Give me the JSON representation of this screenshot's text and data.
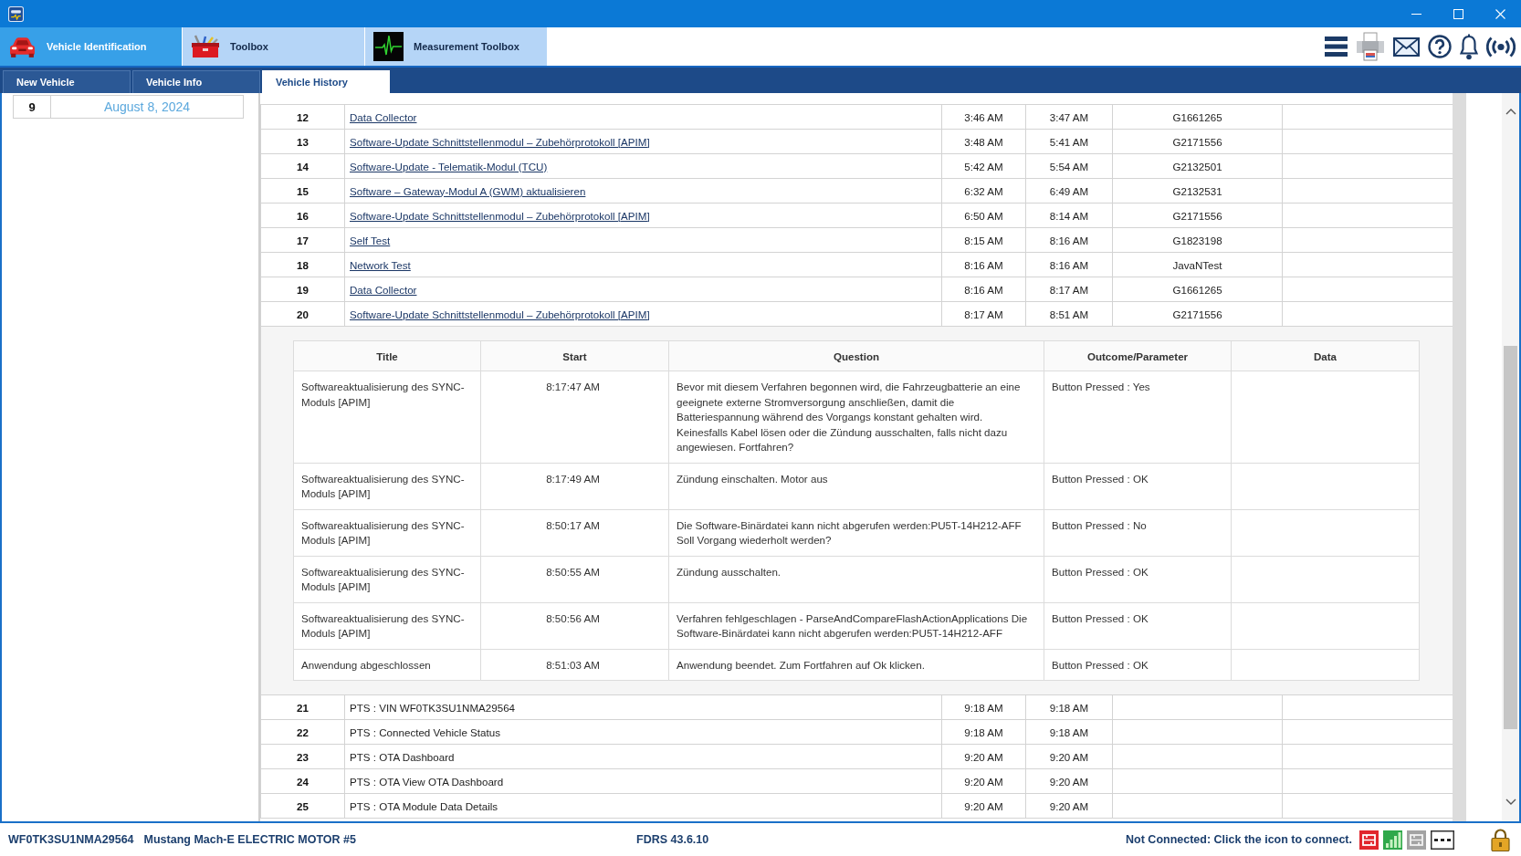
{
  "top_tabs": [
    {
      "label": "Vehicle Identification",
      "selected": true
    },
    {
      "label": "Toolbox",
      "selected": false
    },
    {
      "label": "Measurement Toolbox",
      "selected": false
    }
  ],
  "sub_tabs": [
    {
      "label": "New Vehicle",
      "selected": false
    },
    {
      "label": "Vehicle Info",
      "selected": false
    },
    {
      "label": "Vehicle History",
      "selected": true
    }
  ],
  "sessions_list": {
    "rows": [
      {
        "column_1": "9",
        "column_2": "August 8, 2024"
      }
    ]
  },
  "history_table": {
    "rows": [
      {
        "kind": "link",
        "column_1": "12",
        "column_2": "Data Collector",
        "column_3": "3:46 AM",
        "column_4": "3:47 AM",
        "column_5": "G1661265"
      },
      {
        "kind": "link",
        "column_1": "13",
        "column_2": "Software-Update Schnittstellenmodul – Zubehörprotokoll [APIM]",
        "column_3": "3:48 AM",
        "column_4": "5:41 AM",
        "column_5": "G2171556"
      },
      {
        "kind": "link",
        "column_1": "14",
        "column_2": "Software-Update - Telematik-Modul (TCU)",
        "column_3": "5:42 AM",
        "column_4": "5:54 AM",
        "column_5": "G2132501"
      },
      {
        "kind": "link",
        "column_1": "15",
        "column_2": "Software – Gateway-Modul A (GWM) aktualisieren",
        "column_3": "6:32 AM",
        "column_4": "6:49 AM",
        "column_5": "G2132531"
      },
      {
        "kind": "link",
        "column_1": "16",
        "column_2": "Software-Update Schnittstellenmodul – Zubehörprotokoll [APIM]",
        "column_3": "6:50 AM",
        "column_4": "8:14 AM",
        "column_5": "G2171556"
      },
      {
        "kind": "link",
        "column_1": "17",
        "column_2": "Self Test",
        "column_3": "8:15 AM",
        "column_4": "8:16 AM",
        "column_5": "G1823198"
      },
      {
        "kind": "link",
        "column_1": "18",
        "column_2": "Network Test",
        "column_3": "8:16 AM",
        "column_4": "8:16 AM",
        "column_5": "JavaNTest"
      },
      {
        "kind": "link",
        "column_1": "19",
        "column_2": "Data Collector",
        "column_3": "8:16 AM",
        "column_4": "8:17 AM",
        "column_5": "G1661265"
      },
      {
        "kind": "link",
        "column_1": "20",
        "column_2": "Software-Update Schnittstellenmodul – Zubehörprotokoll [APIM]",
        "column_3": "8:17 AM",
        "column_4": "8:51 AM",
        "column_5": "G2171556",
        "details": {
          "columns": [
            "Title",
            "Start",
            "Question",
            "Outcome/Parameter",
            "Data"
          ],
          "rows": [
            {
              "title": "Softwareaktualisierung des SYNC-Moduls [APIM]",
              "start": "8:17:47 AM",
              "question": "Bevor mit diesem Verfahren begonnen wird, die Fahrzeugbatterie an eine geeignete externe Stromversorgung anschließen, damit die Batteriespannung während des Vorgangs konstant gehalten wird. Keinesfalls Kabel lösen oder die Zündung ausschalten, falls nicht dazu angewiesen. Fortfahren?",
              "outcome_parameter": "Button Pressed : Yes"
            },
            {
              "title": "Softwareaktualisierung des SYNC-Moduls [APIM]",
              "start": "8:17:49 AM",
              "question": "Zündung einschalten. Motor aus",
              "outcome_parameter": "Button Pressed : OK"
            },
            {
              "title": "Softwareaktualisierung des SYNC-Moduls [APIM]",
              "start": "8:50:17 AM",
              "question": "Die Software-Binärdatei kann nicht abgerufen werden:PU5T-14H212-AFF Soll Vorgang wiederholt werden?",
              "outcome_parameter": "Button Pressed : No"
            },
            {
              "title": "Softwareaktualisierung des SYNC-Moduls [APIM]",
              "start": "8:50:55 AM",
              "question": "Zündung ausschalten.",
              "outcome_parameter": "Button Pressed : OK"
            },
            {
              "title": "Softwareaktualisierung des SYNC-Moduls [APIM]",
              "start": "8:50:56 AM",
              "question": "Verfahren fehlgeschlagen - ParseAndCompareFlashActionApplications Die Software-Binärdatei kann nicht abgerufen werden:PU5T-14H212-AFF",
              "outcome_parameter": "Button Pressed : OK"
            },
            {
              "title": "Anwendung abgeschlossen",
              "start": "8:51:03 AM",
              "question": "Anwendung beendet. Zum Fortfahren auf Ok klicken.",
              "outcome_parameter": "Button Pressed : OK"
            }
          ]
        }
      },
      {
        "kind": "plain",
        "column_1": "21",
        "column_2": "PTS : VIN WF0TK3SU1NMA29564",
        "column_3": "9:18 AM",
        "column_4": "9:18 AM"
      },
      {
        "kind": "plain",
        "column_1": "22",
        "column_2": "PTS : Connected Vehicle Status",
        "column_3": "9:18 AM",
        "column_4": "9:18 AM"
      },
      {
        "kind": "plain",
        "column_1": "23",
        "column_2": "PTS : OTA Dashboard",
        "column_3": "9:20 AM",
        "column_4": "9:20 AM"
      },
      {
        "kind": "plain",
        "column_1": "24",
        "column_2": "PTS : OTA View OTA Dashboard",
        "column_3": "9:20 AM",
        "column_4": "9:20 AM"
      },
      {
        "kind": "plain",
        "column_1": "25",
        "column_2": "PTS : OTA Module Data Details",
        "column_3": "9:20 AM",
        "column_4": "9:20 AM"
      }
    ]
  },
  "status_bar": {
    "vin": "WF0TK3SU1NMA29564",
    "vehicle": "Mustang Mach-E ELECTRIC MOTOR #5",
    "version": "FDRS 43.6.10",
    "connection": "Not Connected: Click the icon to connect."
  }
}
